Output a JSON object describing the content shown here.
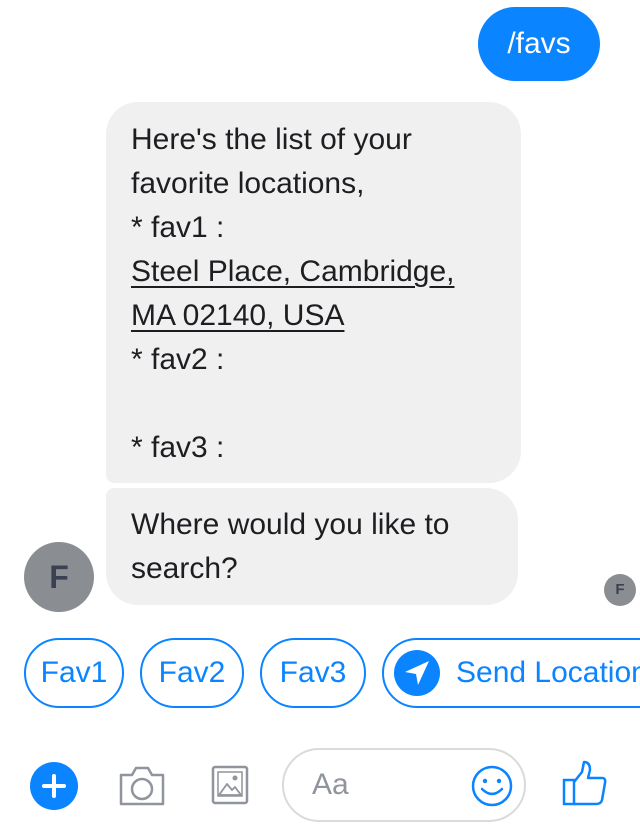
{
  "colors": {
    "accent": "#0a84ff",
    "bubble_in": "#f1f0f0",
    "avatar_bg": "#8a8d91"
  },
  "messages": {
    "outgoing": "/favs",
    "incoming_1": {
      "line1": "Here's the list of your",
      "line2": "favorite locations,",
      "line3": "* fav1 :",
      "address_line1": "Steel Place, Cambridge,",
      "address_line2": "MA 02140, USA",
      "line4": "* fav2 :",
      "line5": "* fav3 :"
    },
    "incoming_2": {
      "line1": "Where would you like to",
      "line2": "search?"
    }
  },
  "bot": {
    "avatar_initial": "F",
    "read_receipt_initial": "F"
  },
  "quick_replies": {
    "fav1": "Fav1",
    "fav2": "Fav2",
    "fav3": "Fav3",
    "send_location": "Send Location",
    "send_location_icon": "location-arrow-icon"
  },
  "composer": {
    "placeholder": "Aa",
    "icons": [
      "plus-icon",
      "camera-icon",
      "image-icon",
      "emoji-icon",
      "thumbs-up-icon"
    ]
  }
}
